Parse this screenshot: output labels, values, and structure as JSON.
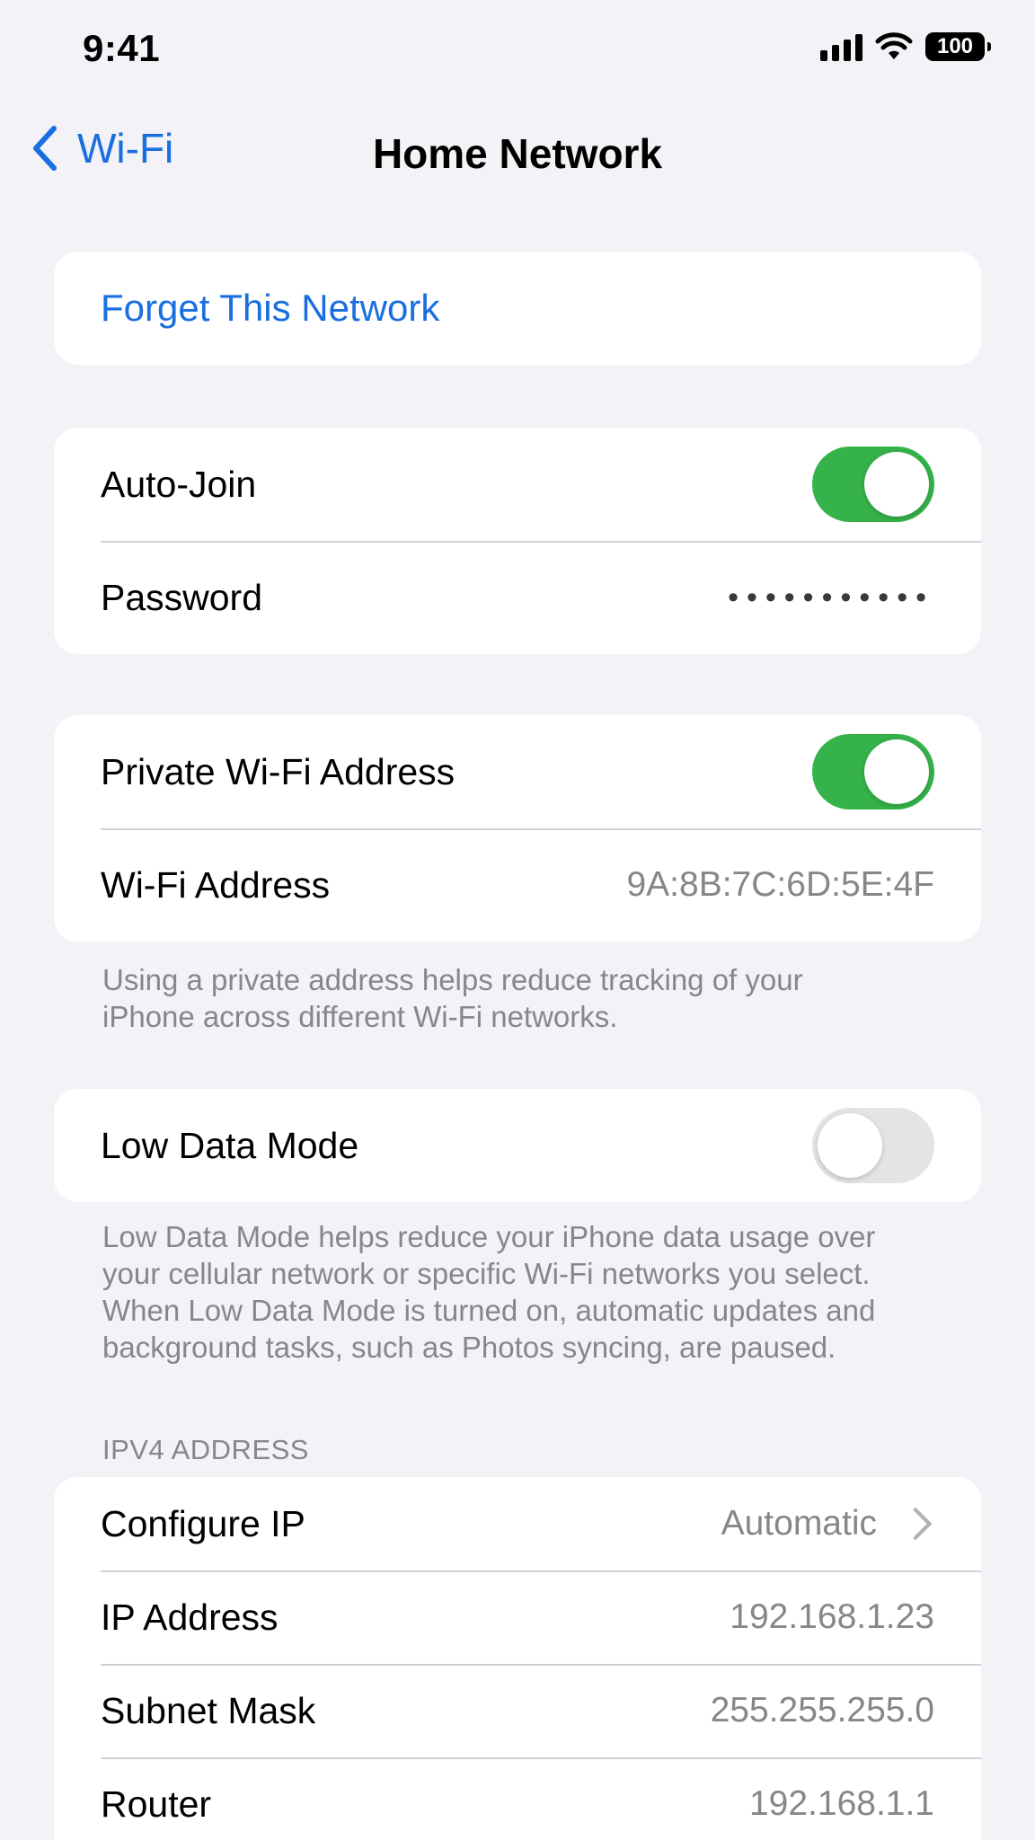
{
  "status_bar": {
    "time": "9:41",
    "battery": "100"
  },
  "nav": {
    "back_label": "Wi-Fi",
    "title": "Home Network"
  },
  "forget_card": {
    "label": "Forget This Network"
  },
  "join_card": {
    "auto_join_label": "Auto-Join",
    "auto_join_on": true,
    "password_label": "Password",
    "password_value": "•••••••••••"
  },
  "address_card": {
    "private_label": "Private Wi-Fi Address",
    "private_on": true,
    "address_label": "Wi-Fi Address",
    "address_value": "9A:8B:7C:6D:5E:4F",
    "footnote": "Using a private address helps reduce tracking of your iPhone across different Wi-Fi networks."
  },
  "low_data_card": {
    "label": "Low Data Mode",
    "on": false,
    "footnote": "Low Data Mode helps reduce your iPhone data usage over your cellular network or specific Wi-Fi networks you select. When Low Data Mode is turned on, automatic updates and background tasks, such as Photos syncing, are paused."
  },
  "ipv4": {
    "header": "IPV4 ADDRESS",
    "configure_label": "Configure IP",
    "configure_value": "Automatic",
    "ip_label": "IP Address",
    "ip_value": "192.168.1.23",
    "subnet_label": "Subnet Mask",
    "subnet_value": "255.255.255.0",
    "router_label": "Router",
    "router_value": "192.168.1.1"
  },
  "colors": {
    "accent": "#1a6fe0",
    "toggle_on": "#35b24a",
    "background": "#f2f2f7"
  }
}
